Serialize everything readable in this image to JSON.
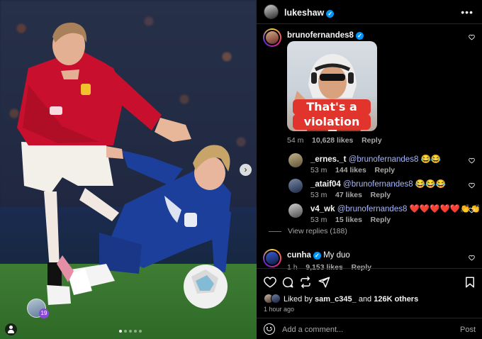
{
  "post": {
    "author": "lukeshaw",
    "verified": true,
    "more_label": "•••",
    "time_ago": "1 hour ago",
    "likes": {
      "prefix": "Liked by ",
      "user": "sam_c345_",
      "middle": " and ",
      "count": "126K others"
    },
    "carousel": {
      "slides": 5,
      "active": 1
    },
    "media_tag_count": "19"
  },
  "comments": [
    {
      "user": "brunofernandes8",
      "verified": true,
      "text": "",
      "sticker_text_1": "That's a",
      "sticker_text_2": "violation",
      "time": "54 m",
      "likes": "10,628 likes",
      "reply": "Reply"
    },
    {
      "user": "_ernes._t",
      "mention": "@brunofernandes8",
      "text": "😂😂",
      "time": "53 m",
      "likes": "144 likes",
      "reply": "Reply"
    },
    {
      "user": "_ataif04",
      "mention": "@brunofernandes8",
      "text": "😂😂😂",
      "time": "53 m",
      "likes": "47 likes",
      "reply": "Reply"
    },
    {
      "user": "v4_wk",
      "mention": "@brunofernandes8",
      "text": "❤️❤️❤️❤️❤️👏👏",
      "time": "53 m",
      "likes": "15 likes",
      "reply": "Reply"
    },
    {
      "user": "cunha",
      "verified": true,
      "text": "My duo",
      "time": "1 h",
      "likes": "9,153 likes",
      "reply": "Reply"
    }
  ],
  "view_replies": "View replies (188)",
  "add_comment": {
    "placeholder": "Add a comment...",
    "post_label": "Post"
  },
  "colors": {
    "verified": "#0095f6",
    "mention": "#a7b7ff",
    "muted": "#a8a8a8",
    "united_red": "#c8102e",
    "chelsea_blue": "#1d3f9c"
  },
  "icons": [
    "heart-icon",
    "comment-icon",
    "repost-icon",
    "share-icon",
    "bookmark-icon",
    "emoji-icon",
    "chevron-right-icon",
    "more-icon"
  ]
}
